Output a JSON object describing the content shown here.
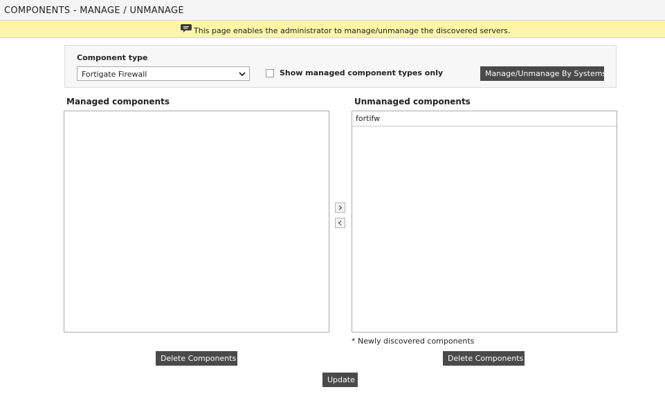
{
  "header": {
    "title": "COMPONENTS - MANAGE / UNMANAGE"
  },
  "info_bar": {
    "icon": "speech-bubble-icon",
    "text": "This page enables the administrator to manage/unmanage the discovered servers."
  },
  "filter": {
    "label": "Component type",
    "selected_type": "Fortigate Firewall",
    "checkbox_label": "Show managed component types only",
    "checkbox_checked": false,
    "systems_button": "Manage/Unmanage By Systems"
  },
  "managed": {
    "title": "Managed components",
    "items": [],
    "delete_button": "Delete Components"
  },
  "unmanaged": {
    "title": "Unmanaged components",
    "items": [
      "fortifw"
    ],
    "footnote": "* Newly discovered components",
    "delete_button": "Delete Components"
  },
  "actions": {
    "update_button": "Update"
  },
  "colors": {
    "info_bar_bg": "#fdf6a6",
    "button_bg": "#4a4a4a",
    "header_bg": "#f5f5f5"
  }
}
